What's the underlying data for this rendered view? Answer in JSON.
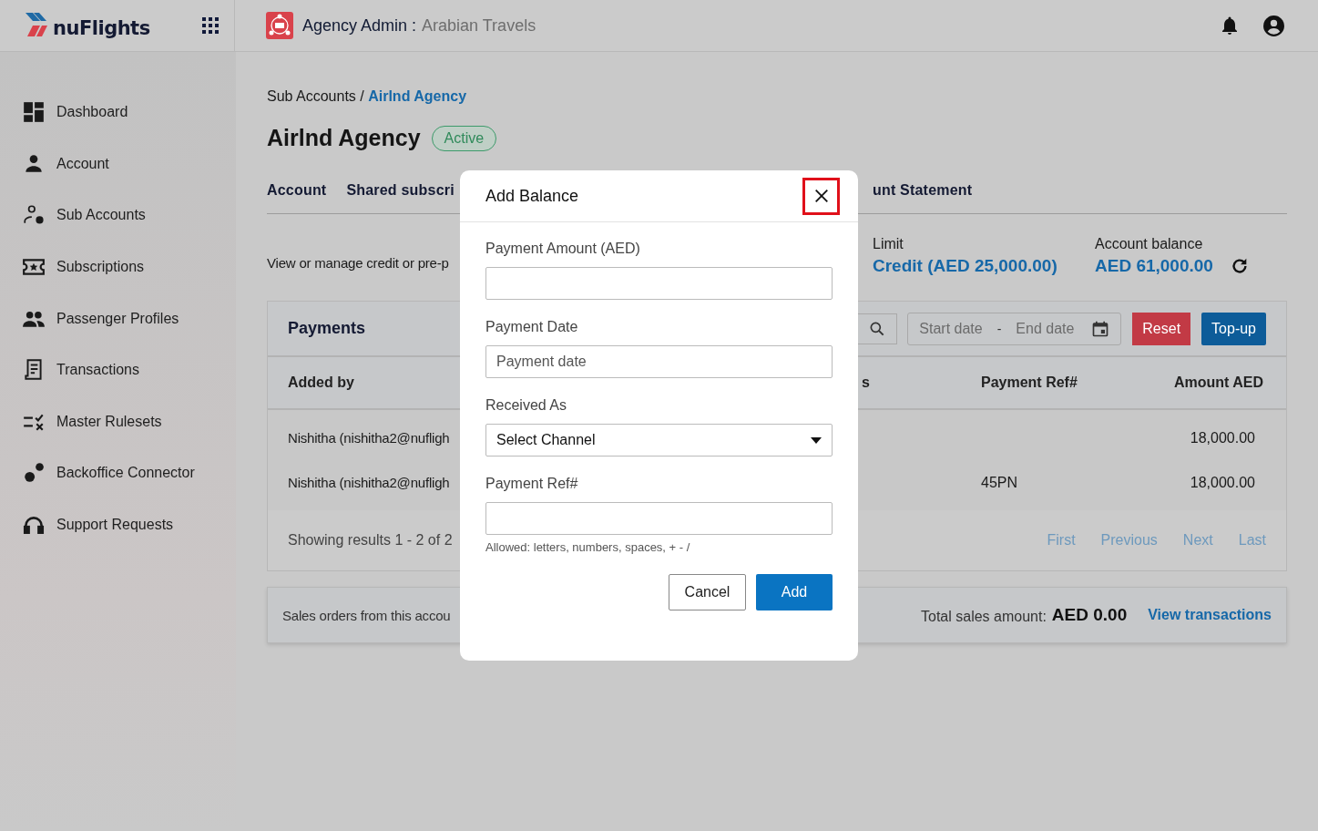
{
  "header": {
    "logo_text": "nuFlights",
    "title": "Agency Admin :",
    "agency": "Arabian Travels"
  },
  "sidebar": {
    "items": [
      {
        "label": "Dashboard"
      },
      {
        "label": "Account"
      },
      {
        "label": "Sub Accounts"
      },
      {
        "label": "Subscriptions"
      },
      {
        "label": "Passenger Profiles"
      },
      {
        "label": "Transactions"
      },
      {
        "label": "Master Rulesets"
      },
      {
        "label": "Backoffice Connector"
      },
      {
        "label": "Support Requests"
      }
    ]
  },
  "breadcrumb": {
    "parent": "Sub Accounts /",
    "current": "Airlnd Agency"
  },
  "page_title": "Airlnd Agency",
  "status_badge": "Active",
  "tabs": [
    "Account",
    "Shared subscri",
    "unt Statement"
  ],
  "info": {
    "description": "View or manage credit or pre-p",
    "limit_label": "Limit",
    "limit_value": "Credit (AED 25,000.00)",
    "balance_label": "Account balance",
    "balance_value": "AED 61,000.00"
  },
  "payments": {
    "title": "Payments",
    "start_placeholder": "Start date",
    "range_separator": "-",
    "end_placeholder": "End date",
    "reset": "Reset",
    "topup": "Top-up",
    "columns": [
      "Added by",
      "s",
      "Payment Ref#",
      "Amount AED"
    ],
    "rows": [
      [
        "Nishitha (nishitha2@nufligh",
        "",
        "",
        "18,000.00"
      ],
      [
        "Nishitha (nishitha2@nufligh",
        "",
        "45PN",
        "18,000.00"
      ]
    ],
    "results": "Showing results 1 - 2 of 2",
    "pages": [
      "First",
      "Previous",
      "Next",
      "Last"
    ]
  },
  "sales": {
    "text": "Sales orders from this accou",
    "total_label": "Total sales amount:",
    "total_value": "AED 0.00",
    "link": "View transactions"
  },
  "modal": {
    "title": "Add Balance",
    "fields": [
      {
        "kind": "text",
        "label": "Payment Amount (AED)"
      },
      {
        "kind": "date",
        "label": "Payment Date",
        "placeholder": "Payment date"
      },
      {
        "kind": "select",
        "label": "Received As",
        "value": "Select Channel"
      },
      {
        "kind": "text",
        "label": "Payment Ref#",
        "hint": "Allowed: letters, numbers, spaces, + - /"
      }
    ],
    "cancel": "Cancel",
    "submit": "Add"
  }
}
